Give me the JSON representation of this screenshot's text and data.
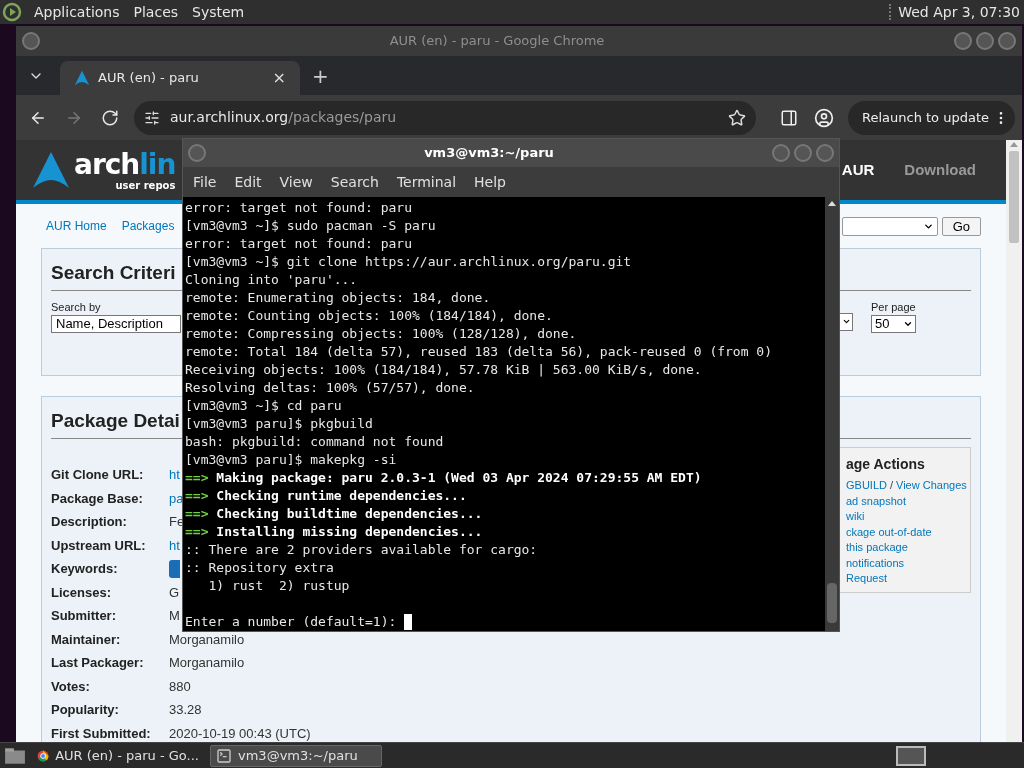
{
  "top_panel": {
    "menus": [
      "Applications",
      "Places",
      "System"
    ],
    "clock": "Wed Apr 3, 07:30"
  },
  "browser": {
    "title": "AUR (en) - paru - Google Chrome",
    "tabs": [
      {
        "label": "AUR (en) - paru",
        "selected": true,
        "close": "×"
      }
    ],
    "new_tab": "+",
    "nav_buttons": [
      {
        "kind": "back",
        "disabled": false
      },
      {
        "kind": "forward",
        "disabled": true
      },
      {
        "kind": "reload",
        "disabled": false
      }
    ],
    "address": {
      "host": "aur.archlinux.org",
      "path": "/packages/paru"
    },
    "relaunch_button": "Relaunch to update"
  },
  "page": {
    "logo": {
      "word": "arch",
      "word_2": "lin",
      "tagline": "user repos"
    },
    "header_nav": [
      {
        "label": "AUR",
        "selected": true
      },
      {
        "label": "Download",
        "selected": false
      }
    ],
    "breadcrumbs": [
      "AUR Home",
      "Packages"
    ],
    "go_button": "Go",
    "search_criteria": {
      "title": "Search Criteri",
      "search_by": {
        "label": "Search by",
        "value": "Name, Description"
      },
      "per_page": {
        "label": "Per page",
        "value": "50"
      }
    },
    "package_details": {
      "title": "Package Detai",
      "rows": [
        {
          "label": "Git Clone URL:",
          "value": "ht",
          "kind": "link"
        },
        {
          "label": "Package Base:",
          "value": "pa",
          "kind": "link"
        },
        {
          "label": "Description:",
          "value": "Fe",
          "kind": "text"
        },
        {
          "label": "Upstream URL:",
          "value": "ht",
          "kind": "link"
        },
        {
          "label": "Keywords:",
          "kind": "tag"
        },
        {
          "label": "Licenses:",
          "value": "G",
          "kind": "text"
        },
        {
          "label": "Submitter:",
          "value": "M",
          "kind": "text"
        },
        {
          "label": "Maintainer:",
          "value": "Morganamilo",
          "kind": "text"
        },
        {
          "label": "Last Packager:",
          "value": "Morganamilo",
          "kind": "text"
        },
        {
          "label": "Votes:",
          "value": "880",
          "kind": "text"
        },
        {
          "label": "Popularity:",
          "value": "33.28",
          "kind": "text"
        },
        {
          "label": "First Submitted:",
          "value": "2020-10-19 00:43 (UTC)",
          "kind": "text"
        }
      ],
      "actions": {
        "title": "age Actions",
        "lines": [
          [
            {
              "text": "GBUILD",
              "kind": "link"
            },
            {
              "text": "/",
              "kind": "text"
            },
            {
              "text": "View Changes",
              "kind": "link"
            }
          ],
          [
            {
              "text": "ad snapshot",
              "kind": "link"
            }
          ],
          [
            {
              "text": "wiki",
              "kind": "link"
            }
          ],
          [
            {
              "text": "ckage out-of-date",
              "kind": "link"
            }
          ],
          [
            {
              "text": "this package",
              "kind": "link"
            }
          ],
          [
            {
              "text": "notifications",
              "kind": "link"
            }
          ],
          [
            {
              "text": "Request",
              "kind": "link"
            }
          ]
        ]
      }
    }
  },
  "terminal": {
    "title": "vm3@vm3:~/paru",
    "menus": [
      "File",
      "Edit",
      "View",
      "Search",
      "Terminal",
      "Help"
    ],
    "lines": [
      {
        "kind": "plain",
        "text": "error: target not found: paru"
      },
      {
        "kind": "plain",
        "text": "[vm3@vm3 ~]$ sudo pacman -S paru"
      },
      {
        "kind": "plain",
        "text": "error: target not found: paru"
      },
      {
        "kind": "plain",
        "text": "[vm3@vm3 ~]$ git clone https://aur.archlinux.org/paru.git"
      },
      {
        "kind": "plain",
        "text": "Cloning into 'paru'..."
      },
      {
        "kind": "plain",
        "text": "remote: Enumerating objects: 184, done."
      },
      {
        "kind": "plain",
        "text": "remote: Counting objects: 100% (184/184), done."
      },
      {
        "kind": "plain",
        "text": "remote: Compressing objects: 100% (128/128), done."
      },
      {
        "kind": "plain",
        "text": "remote: Total 184 (delta 57), reused 183 (delta 56), pack-reused 0 (from 0)"
      },
      {
        "kind": "plain",
        "text": "Receiving objects: 100% (184/184), 57.78 KiB | 563.00 KiB/s, done."
      },
      {
        "kind": "plain",
        "text": "Resolving deltas: 100% (57/57), done."
      },
      {
        "kind": "plain",
        "text": "[vm3@vm3 ~]$ cd paru"
      },
      {
        "kind": "plain",
        "text": "[vm3@vm3 paru]$ pkgbuild"
      },
      {
        "kind": "plain",
        "text": "bash: pkgbuild: command not found"
      },
      {
        "kind": "plain",
        "text": "[vm3@vm3 paru]$ makepkg -si"
      },
      {
        "kind": "step",
        "prefix": "==>",
        "text": "Making package: paru 2.0.3-1 (Wed 03 Apr 2024 07:29:55 AM EDT)"
      },
      {
        "kind": "step",
        "prefix": "==>",
        "text": "Checking runtime dependencies..."
      },
      {
        "kind": "step",
        "prefix": "==>",
        "text": "Checking buildtime dependencies..."
      },
      {
        "kind": "step",
        "prefix": "==>",
        "text": "Installing missing dependencies..."
      },
      {
        "kind": "plain",
        "text": ":: There are 2 providers available for cargo:"
      },
      {
        "kind": "plain",
        "text": ":: Repository extra"
      },
      {
        "kind": "plain",
        "text": "   1) rust  2) rustup"
      },
      {
        "kind": "blank"
      },
      {
        "kind": "input",
        "text": "Enter a number (default=1): "
      }
    ]
  },
  "taskbar": {
    "tasks": [
      {
        "kind": "browser",
        "label": "AUR (en) - paru - Go...",
        "selected": false
      },
      {
        "kind": "terminal",
        "label": "vm3@vm3:~/paru",
        "selected": true
      }
    ]
  }
}
